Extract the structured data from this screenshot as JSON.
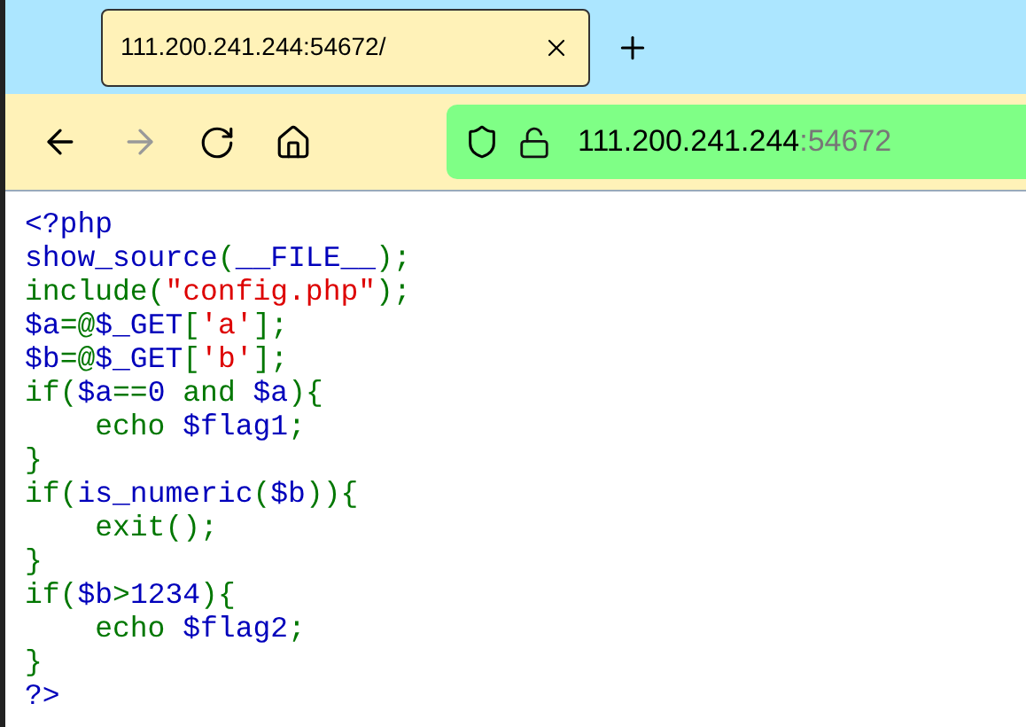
{
  "tab": {
    "title": "111.200.241.244:54672/",
    "selected": true
  },
  "address_bar": {
    "host": "111.200.241.244",
    "port": ":54672"
  },
  "code": [
    [
      {
        "text": "<?php",
        "kind": "default"
      }
    ],
    [
      {
        "text": "show_source",
        "kind": "default"
      },
      {
        "text": "(",
        "kind": "keyword"
      },
      {
        "text": "__FILE__",
        "kind": "default"
      },
      {
        "text": ");",
        "kind": "keyword"
      }
    ],
    [
      {
        "text": "include(",
        "kind": "keyword"
      },
      {
        "text": "\"config.php\"",
        "kind": "string"
      },
      {
        "text": ");",
        "kind": "keyword"
      }
    ],
    [
      {
        "text": "$a",
        "kind": "default"
      },
      {
        "text": "=@",
        "kind": "keyword"
      },
      {
        "text": "$_GET",
        "kind": "default"
      },
      {
        "text": "[",
        "kind": "keyword"
      },
      {
        "text": "'a'",
        "kind": "string"
      },
      {
        "text": "];",
        "kind": "keyword"
      }
    ],
    [
      {
        "text": "$b",
        "kind": "default"
      },
      {
        "text": "=@",
        "kind": "keyword"
      },
      {
        "text": "$_GET",
        "kind": "default"
      },
      {
        "text": "[",
        "kind": "keyword"
      },
      {
        "text": "'b'",
        "kind": "string"
      },
      {
        "text": "];",
        "kind": "keyword"
      }
    ],
    [
      {
        "text": "if(",
        "kind": "keyword"
      },
      {
        "text": "$a",
        "kind": "default"
      },
      {
        "text": "==",
        "kind": "keyword"
      },
      {
        "text": "0",
        "kind": "default"
      },
      {
        "text": " and ",
        "kind": "keyword"
      },
      {
        "text": "$a",
        "kind": "default"
      },
      {
        "text": "){",
        "kind": "keyword"
      }
    ],
    [
      {
        "text": "    echo ",
        "kind": "keyword"
      },
      {
        "text": "$flag1",
        "kind": "default"
      },
      {
        "text": ";",
        "kind": "keyword"
      }
    ],
    [
      {
        "text": "}",
        "kind": "keyword"
      }
    ],
    [
      {
        "text": "if(",
        "kind": "keyword"
      },
      {
        "text": "is_numeric",
        "kind": "default"
      },
      {
        "text": "(",
        "kind": "keyword"
      },
      {
        "text": "$b",
        "kind": "default"
      },
      {
        "text": ")){",
        "kind": "keyword"
      }
    ],
    [
      {
        "text": "    exit();",
        "kind": "keyword"
      }
    ],
    [
      {
        "text": "}",
        "kind": "keyword"
      }
    ],
    [
      {
        "text": "if(",
        "kind": "keyword"
      },
      {
        "text": "$b",
        "kind": "default"
      },
      {
        "text": ">",
        "kind": "keyword"
      },
      {
        "text": "1234",
        "kind": "default"
      },
      {
        "text": "){",
        "kind": "keyword"
      }
    ],
    [
      {
        "text": "    echo ",
        "kind": "keyword"
      },
      {
        "text": "$flag2",
        "kind": "default"
      },
      {
        "text": ";",
        "kind": "keyword"
      }
    ],
    [
      {
        "text": "}",
        "kind": "keyword"
      }
    ],
    [
      {
        "text": "?>",
        "kind": "default"
      }
    ]
  ]
}
